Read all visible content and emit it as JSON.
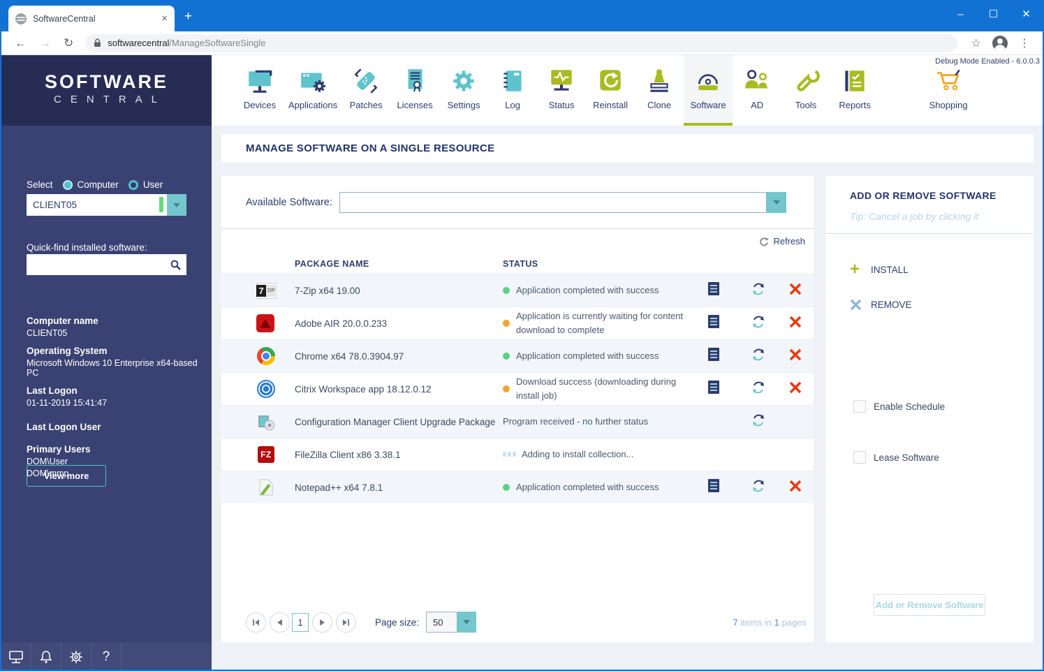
{
  "browser": {
    "tab_title": "SoftwareCentral",
    "tab_close": "×",
    "new_tab": "+",
    "back": "←",
    "forward": "→",
    "reload": "↻",
    "url_host": "softwarecentral",
    "url_path": "/ManageSoftwareSingle",
    "bookmark_star": "☆",
    "menu_dots": "⋮",
    "window_controls": {
      "minimize": "–",
      "maximize": "☐",
      "close": "✕"
    }
  },
  "topnav": {
    "debug_text": "Debug Mode Enabled - 6.0.0.3",
    "items": [
      {
        "label": "Devices",
        "icon": "devices-icon",
        "active": false
      },
      {
        "label": "Applications",
        "icon": "applications-icon",
        "active": false
      },
      {
        "label": "Patches",
        "icon": "patches-icon",
        "active": false
      },
      {
        "label": "Licenses",
        "icon": "licenses-icon",
        "active": false
      },
      {
        "label": "Settings",
        "icon": "settings-icon",
        "active": false
      },
      {
        "label": "Log",
        "icon": "log-icon",
        "active": false
      },
      {
        "label": "Status",
        "icon": "status-icon",
        "active": false
      },
      {
        "label": "Reinstall",
        "icon": "reinstall-icon",
        "active": false
      },
      {
        "label": "Clone",
        "icon": "clone-icon",
        "active": false
      },
      {
        "label": "Software",
        "icon": "software-icon",
        "active": true
      },
      {
        "label": "AD",
        "icon": "ad-icon",
        "active": false
      },
      {
        "label": "Tools",
        "icon": "tools-icon",
        "active": false
      },
      {
        "label": "Reports",
        "icon": "reports-icon",
        "active": false
      },
      {
        "label": "Shopping",
        "icon": "shopping-icon",
        "active": false
      }
    ]
  },
  "sidebar": {
    "logo_line1": "SOFTWARE",
    "logo_line2": "CENTRAL",
    "select_label": "Select",
    "radio_computer": "Computer",
    "radio_user": "User",
    "radio_selected": "Computer",
    "selected_resource": "CLIENT05",
    "quickfind_label": "Quick-find installed software:",
    "quickfind_value": "",
    "info": [
      {
        "label": "Computer name",
        "values": [
          "CLIENT05"
        ]
      },
      {
        "label": "Operating System",
        "values": [
          "Microsoft Windows 10 Enterprise x64-based PC"
        ]
      },
      {
        "label": "Last Logon",
        "values": [
          "01-11-2019 15:41:47"
        ]
      },
      {
        "label": "Last Logon User",
        "values": []
      },
      {
        "label": "Primary Users",
        "values": [
          "DOM\\User",
          "DOM\\mmp"
        ]
      }
    ],
    "view_more_label": "View more",
    "footer_icons": [
      "monitor-icon",
      "bell-icon",
      "gear-icon",
      "help-icon"
    ],
    "help_glyph": "?"
  },
  "main": {
    "page_title": "MANAGE SOFTWARE ON A SINGLE RESOURCE",
    "available_software_label": "Available Software:",
    "available_software_value": "",
    "refresh_label": "Refresh",
    "table": {
      "columns": [
        "PACKAGE NAME",
        "STATUS"
      ],
      "rows": [
        {
          "app_icon": "7zip-icon",
          "name": "7-Zip x64 19.00",
          "status": "Application completed with success",
          "status_dot": "green",
          "actions": [
            "log",
            "copy",
            "retry",
            "cancel"
          ]
        },
        {
          "app_icon": "adobe-air-icon",
          "name": "Adobe AIR 20.0.0.233",
          "status": "Application is currently waiting for content download to complete",
          "status_dot": "orange",
          "actions": [
            "log",
            "copy",
            "retry",
            "cancel"
          ]
        },
        {
          "app_icon": "chrome-icon",
          "name": "Chrome x64 78.0.3904.97",
          "status": "Application completed with success",
          "status_dot": "green",
          "actions": [
            "log",
            "copy",
            "retry",
            "cancel"
          ]
        },
        {
          "app_icon": "citrix-icon",
          "name": "Citrix Workspace app 18.12.0.12",
          "status": "Download success (downloading during install job)",
          "status_dot": "orange",
          "actions": [
            "log",
            "copy",
            "retry",
            "cancel"
          ]
        },
        {
          "app_icon": "configmgr-icon",
          "name": "Configuration Manager Client Upgrade Package",
          "status": "Program received - no further status",
          "status_dot": "none",
          "actions": [
            "copy",
            "retry"
          ]
        },
        {
          "app_icon": "filezilla-icon",
          "name": "FileZilla Client x86 3.38.1",
          "status": "Adding to install collection...",
          "status_dot": "loading",
          "actions": [
            "copy"
          ]
        },
        {
          "app_icon": "notepadpp-icon",
          "name": "Notepad++ x64 7.8.1",
          "status": "Application completed with success",
          "status_dot": "green",
          "actions": [
            "log",
            "copy",
            "retry",
            "cancel"
          ]
        }
      ],
      "filezilla_label": "FZ"
    },
    "pagination": {
      "page": "1",
      "page_size_label": "Page size:",
      "page_size": "50",
      "summary_count": "7",
      "summary_mid": " items in ",
      "summary_pages": "1",
      "summary_end": " pages"
    }
  },
  "panel": {
    "title": "ADD OR REMOVE SOFTWARE",
    "tip": "Tip: Cancel a job by clicking it",
    "install_label": "INSTALL",
    "install_glyph": "+",
    "remove_label": "REMOVE",
    "enable_schedule_label": "Enable Schedule",
    "lease_software_label": "Lease Software",
    "submit_label": "Add or Remove Software",
    "submit_enabled": false
  },
  "colors": {
    "titlebar_blue": "#1272d4",
    "sidebar_navy": "#3a4273",
    "sidebar_header_navy": "#262c54",
    "accent_teal": "#74c7cd",
    "accent_olive": "#a8bc22",
    "accent_orange": "#f6a21d",
    "navy_text": "#2c3e6e",
    "status_green": "#57d286",
    "status_orange": "#f5a42c",
    "cancel_red": "#e9390f",
    "valid_green": "#63dd74"
  }
}
